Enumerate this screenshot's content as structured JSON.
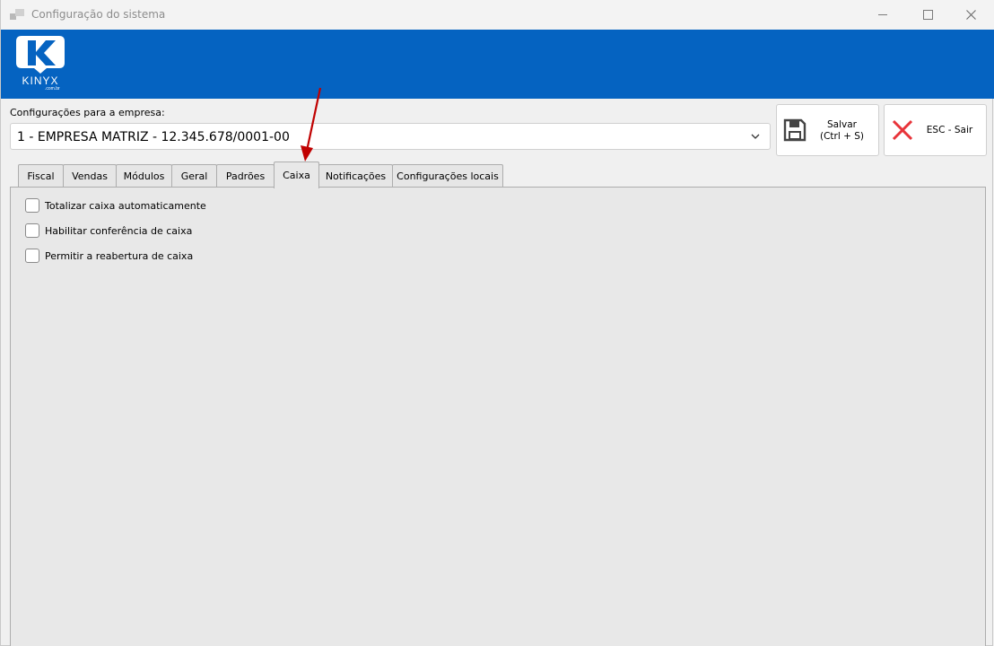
{
  "window": {
    "title": "Configuração do sistema"
  },
  "header": {
    "brand": "KINYX",
    "brand_sub": ".com.br",
    "brand_color": "#0563c1"
  },
  "company": {
    "label": "Configurações para a empresa:",
    "selected": "1 - EMPRESA MATRIZ - 12.345.678/0001-00"
  },
  "actions": {
    "save_line1": "Salvar",
    "save_line2": "(Ctrl + S)",
    "exit_label": "ESC - Sair",
    "exit_color": "#e8343a"
  },
  "tabs": [
    {
      "label": "Fiscal"
    },
    {
      "label": "Vendas"
    },
    {
      "label": "Módulos"
    },
    {
      "label": "Geral"
    },
    {
      "label": "Padrões"
    },
    {
      "label": "Caixa",
      "active": true
    },
    {
      "label": "Notificações"
    },
    {
      "label": "Configurações locais"
    }
  ],
  "caixa_options": [
    {
      "label": "Totalizar caixa automaticamente",
      "checked": false
    },
    {
      "label": "Habilitar conferência de caixa",
      "checked": false
    },
    {
      "label": "Permitir a reabertura de caixa",
      "checked": false
    }
  ],
  "annotation": {
    "arrow_color": "#c00000"
  }
}
